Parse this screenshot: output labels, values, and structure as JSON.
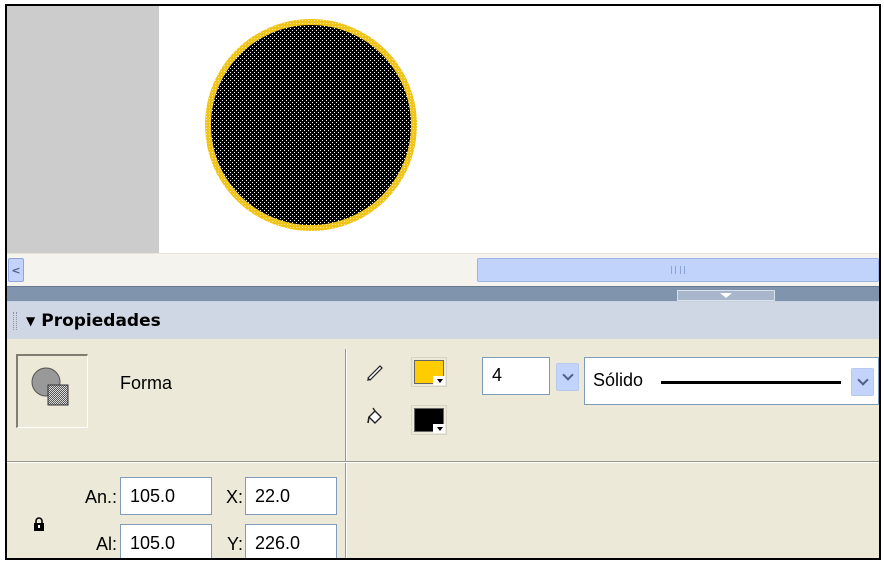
{
  "stage": {
    "circle": {
      "fill_color": "#000000",
      "stroke_color": "#f0c419"
    }
  },
  "panel": {
    "title": "Propiedades",
    "collapse_icon": "triangle-down-icon"
  },
  "shape": {
    "type_label": "Forma",
    "icon": "shape-icon"
  },
  "stroke": {
    "pencil_icon": "pencil-icon",
    "fill_icon": "paint-bucket-icon",
    "stroke_color": "#ffcc00",
    "fill_color": "#000000",
    "height_value": "4",
    "style_value": "Sólido"
  },
  "dimensions": {
    "width_label": "An.:",
    "width_value": "105.0",
    "height_label": "Al:",
    "height_value": "105.0",
    "x_label": "X:",
    "x_value": "22.0",
    "y_label": "Y:",
    "y_value": "226.0",
    "lock_icon": "lock-icon"
  }
}
